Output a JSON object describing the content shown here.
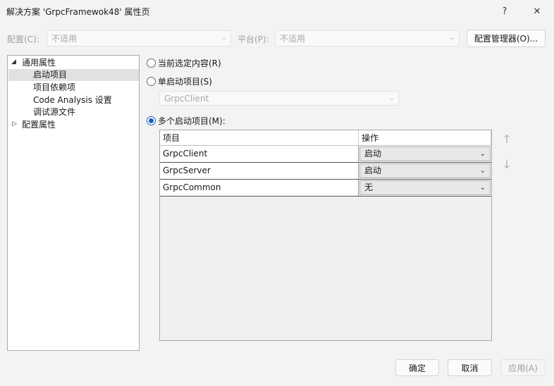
{
  "window": {
    "title": "解决方案 'GrpcFramewok48' 属性页",
    "help_glyph": "?",
    "close_glyph": "✕"
  },
  "toolbar": {
    "config_label": "配置(C):",
    "config_value": "不适用",
    "platform_label": "平台(P):",
    "platform_value": "不适用",
    "config_manager_label": "配置管理器(O)..."
  },
  "tree": {
    "items": [
      {
        "label": "通用属性",
        "expander": "◢"
      },
      {
        "label": "启动项目"
      },
      {
        "label": "项目依赖项"
      },
      {
        "label": "Code Analysis 设置"
      },
      {
        "label": "调试源文件"
      },
      {
        "label": "配置属性",
        "expander": "▷"
      }
    ]
  },
  "startup": {
    "current_selection_label": "当前选定内容(R)",
    "single_label": "单启动项目(S)",
    "single_value": "GrpcClient",
    "multiple_label": "多个启动项目(M):",
    "selected_option": "multiple"
  },
  "grid": {
    "columns": [
      "项目",
      "操作"
    ],
    "rows": [
      {
        "project": "GrpcClient",
        "action": "启动"
      },
      {
        "project": "GrpcServer",
        "action": "启动"
      },
      {
        "project": "GrpcCommon",
        "action": "无"
      }
    ]
  },
  "move": {
    "up_glyph": "↑",
    "down_glyph": "↓"
  },
  "footer": {
    "ok_label": "确定",
    "cancel_label": "取消",
    "apply_label": "应用(A)"
  },
  "icons": {
    "chevron": "⌄"
  }
}
